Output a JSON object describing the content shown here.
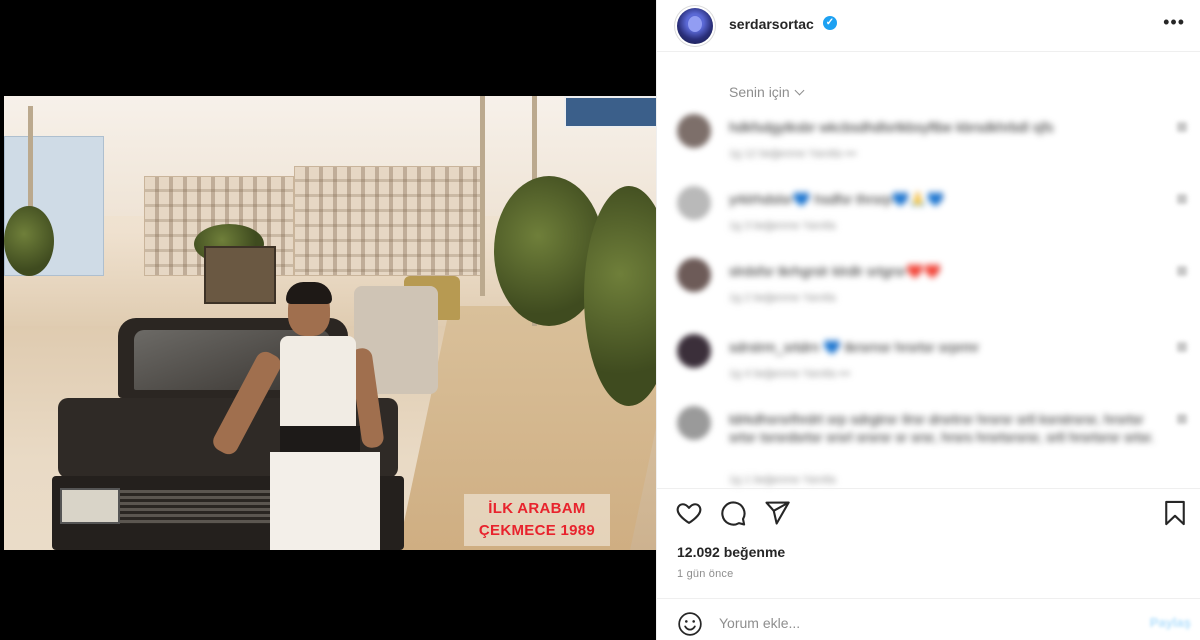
{
  "post": {
    "username": "serdarsortac",
    "verified_mark": "✓",
    "more_label": "•••",
    "photo_caption_line1": "İLK ARABAM",
    "photo_caption_line2": "ÇEKMECE 1989"
  },
  "comments_filter": {
    "label": "Senin için"
  },
  "comments": [
    {
      "text": "hdkfsdgytksbr wkcbsdhdlsrtkbsyftbe kbrsdkhrbdl sjfs",
      "meta": "1g   12 beğenme   Yanıtla   •••",
      "avatar_color": "#7d6f6a"
    },
    {
      "text": "yrklrhdslsr💙 hsdfsr thrsrp💙🙏💙",
      "meta": "1g   3 beğenme   Yanıtla",
      "avatar_color": "#b9b9b9"
    },
    {
      "text": "slrdsfsr tkrhgrslr klrdlr srtgrsr❤️❤️",
      "meta": "1g   2 beğenme   Yanıtla",
      "avatar_color": "#6d5b58"
    },
    {
      "text": "sdrstrm_srtdrn 💙 tkrsrnsr hrsrtsr srprmr",
      "meta": "1g   4 beğenme   Yanıtla   •••",
      "avatar_color": "#3b2f3a"
    },
    {
      "text": "tdrkdhsrsrlhrdrt srp sdrgtrsr Ilrsr drsrtrsr hrsrsr srtl ksrstrsrsr, hrsrtsr srtsr tsrsrdsrtsr srsrl srsrsr sr srsr, hrsrs hrsrtsrsrsr, srtl hrsrtsrsr srtsr.",
      "meta": "1g   1 beğenme   Yanıtla",
      "avatar_color": "#9a9a9a"
    }
  ],
  "actions": {
    "like_icon": "heart-icon",
    "comment_icon": "comment-icon",
    "share_icon": "share-icon",
    "save_icon": "bookmark-icon"
  },
  "stats": {
    "likes_text": "12.092 beğenme",
    "time_text": "1 gün önce"
  },
  "composer": {
    "placeholder": "Yorum ekle...",
    "post_label": "Paylaş",
    "emoji_icon": "emoji-icon"
  },
  "colors": {
    "caption_red": "#e8232d",
    "verified_blue": "#1da1f2",
    "muted_text": "#8e8e8e"
  }
}
